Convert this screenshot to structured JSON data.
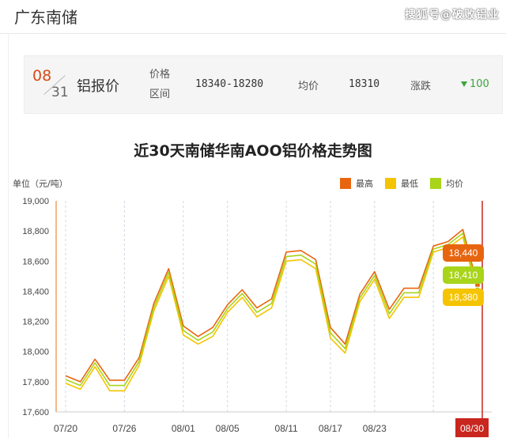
{
  "header": {
    "title": "广东南储",
    "watermark": "搜狐号@破败铝业"
  },
  "price_card": {
    "month": "08",
    "day": "31",
    "product": "铝报价",
    "range_label_line1": "价格",
    "range_label_line2": "区间",
    "range_value": "18340-18280",
    "avg_label": "均价",
    "avg_value": "18310",
    "change_label": "涨跌",
    "change_value": "100",
    "change_color": "#3aa53a"
  },
  "chart_data": {
    "type": "line",
    "title": "近30天南储华南AOO铝价格走势图",
    "ylabel": "单位（元/吨）",
    "ylim": [
      17600,
      19000
    ],
    "yticks": [
      "17,600",
      "17,800",
      "18,000",
      "18,200",
      "18,400",
      "18,600",
      "18,800",
      "19,000"
    ],
    "xtick_labels": [
      "07/20",
      "07/26",
      "08/01",
      "08/05",
      "08/11",
      "08/17",
      "08/23",
      "08/30"
    ],
    "xtick_index": [
      0,
      4,
      8,
      11,
      15,
      18,
      21,
      25
    ],
    "grid": "vertical dashed at ticks",
    "legend_position": "top-right",
    "series": [
      {
        "name": "最高",
        "color": "#e8650f",
        "values": [
          17840,
          17800,
          17950,
          17810,
          17810,
          17960,
          18320,
          18550,
          18170,
          18100,
          18160,
          18310,
          18410,
          18290,
          18350,
          18660,
          18670,
          18610,
          18160,
          18050,
          18380,
          18530,
          18280,
          18420,
          18420,
          18700,
          18730,
          18810,
          18440
        ]
      },
      {
        "name": "最低",
        "color": "#f5c400",
        "values": [
          17790,
          17750,
          17900,
          17740,
          17740,
          17910,
          18270,
          18500,
          18110,
          18050,
          18100,
          18260,
          18360,
          18230,
          18290,
          18600,
          18610,
          18550,
          18090,
          17990,
          18330,
          18480,
          18220,
          18360,
          18360,
          18660,
          18690,
          18760,
          18380
        ]
      },
      {
        "name": "均价",
        "color": "#a8d41a",
        "values": [
          17815,
          17775,
          17925,
          17775,
          17775,
          17935,
          18295,
          18525,
          18140,
          18075,
          18130,
          18285,
          18385,
          18260,
          18320,
          18630,
          18640,
          18580,
          18125,
          18020,
          18355,
          18505,
          18250,
          18390,
          18390,
          18680,
          18710,
          18785,
          18410
        ]
      }
    ],
    "end_labels": [
      {
        "series": "最高",
        "text": "18,440",
        "color": "#e8650f"
      },
      {
        "series": "均价",
        "text": "18,410",
        "color": "#a8d41a"
      },
      {
        "series": "最低",
        "text": "18,380",
        "color": "#f5c400"
      }
    ],
    "cursor_label": "08/30",
    "cursor_color": "#c8261e"
  }
}
